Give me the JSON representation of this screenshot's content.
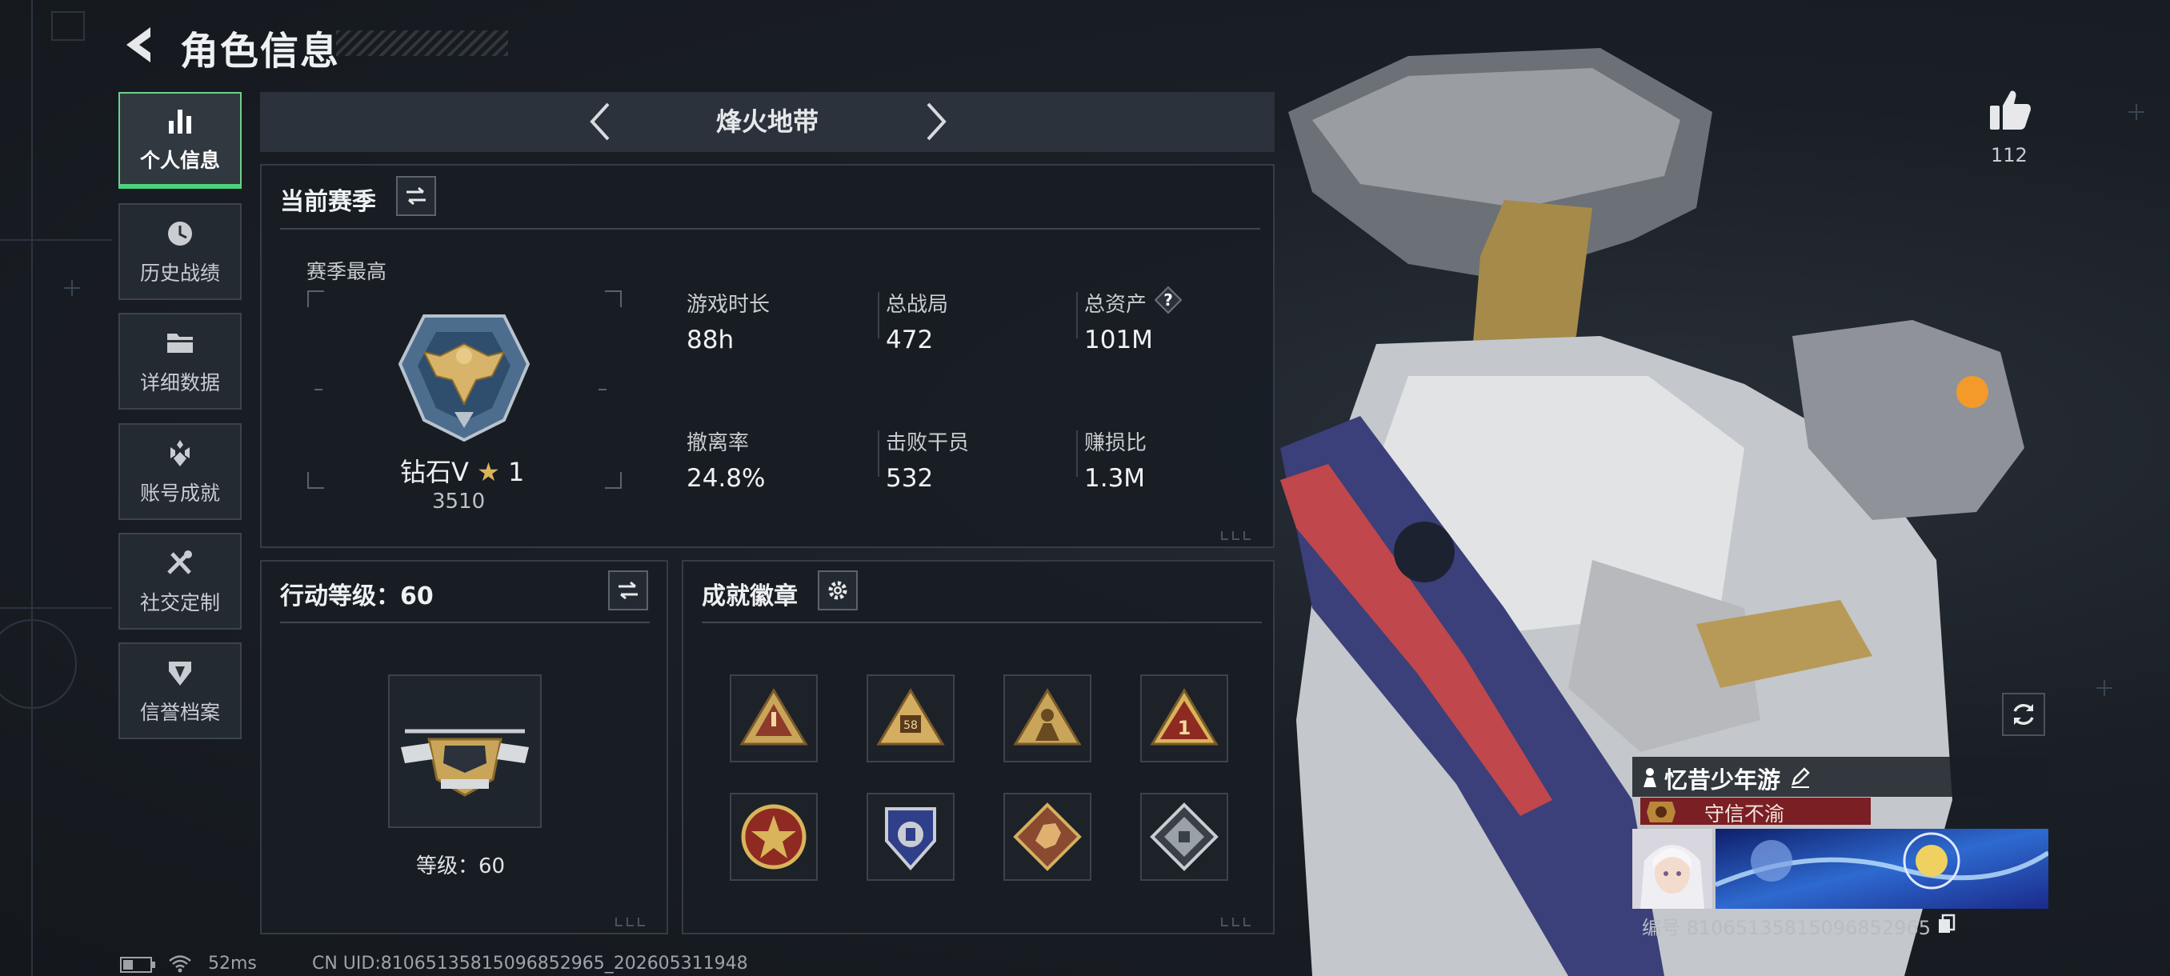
{
  "header": {
    "title": "角色信息"
  },
  "sidebar": {
    "items": [
      {
        "label": "个人信息",
        "icon": "bar-chart-icon",
        "active": true
      },
      {
        "label": "历史战绩",
        "icon": "history-clock-icon",
        "active": false
      },
      {
        "label": "详细数据",
        "icon": "folder-icon",
        "active": false
      },
      {
        "label": "账号成就",
        "icon": "achievement-icon",
        "active": false
      },
      {
        "label": "社交定制",
        "icon": "tools-icon",
        "active": false
      },
      {
        "label": "信誉档案",
        "icon": "shield-icon",
        "active": false
      }
    ]
  },
  "mode": {
    "name": "烽火地带"
  },
  "season": {
    "title": "当前赛季",
    "best_label": "赛季最高",
    "rank_name": "钻石V",
    "rank_stars": "1",
    "rank_score": "3510",
    "stats": [
      {
        "label": "游戏时长",
        "value": "88h"
      },
      {
        "label": "总战局",
        "value": "472"
      },
      {
        "label": "总资产",
        "value": "101M",
        "help": "?"
      },
      {
        "label": "撤离率",
        "value": "24.8%"
      },
      {
        "label": "击败干员",
        "value": "532"
      },
      {
        "label": "赚损比",
        "value": "1.3M"
      }
    ]
  },
  "action_level": {
    "title": "行动等级：60",
    "level_text": "等级：60"
  },
  "achievements": {
    "title": "成就徽章",
    "badges": [
      "warning-triangle-badge",
      "number-58-triangle-badge",
      "soldier-triangle-badge",
      "rank-1-triangle-badge",
      "star-medal-badge",
      "blue-shield-badge",
      "dragon-diamond-badge",
      "silver-emblem-badge"
    ]
  },
  "like": {
    "count": "112"
  },
  "player": {
    "name": "忆昔少年游",
    "honor_title": "守信不渝",
    "id_text": "编号 810651358150968529​65"
  },
  "footer": {
    "ping": "52ms",
    "uid": "CN UID:810651358150968529​65_202605311948"
  },
  "colors": {
    "accent_green": "#4ad37b",
    "honor_red": "#7a1f24",
    "panel_bg": "#181d24"
  }
}
